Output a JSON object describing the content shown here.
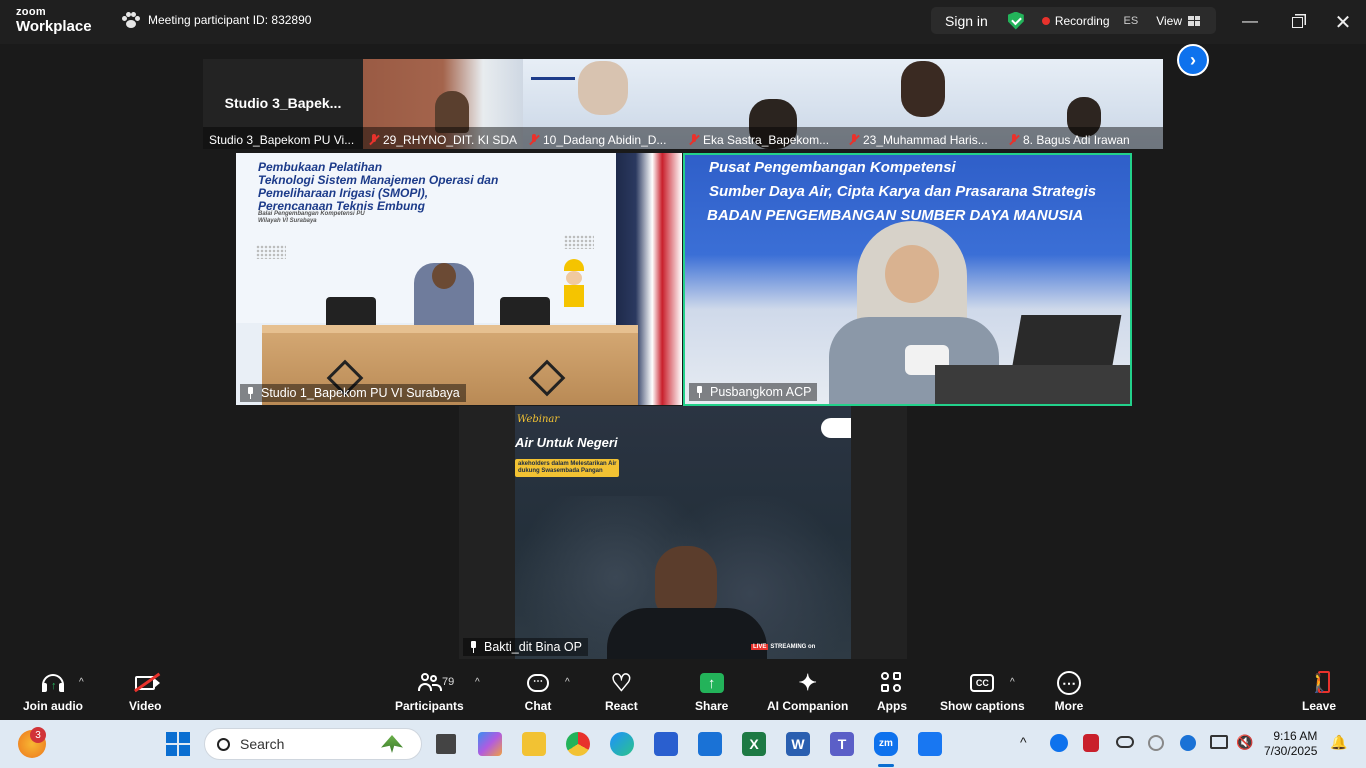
{
  "app": {
    "logo_line1": "zoom",
    "logo_line2": "Workplace",
    "meeting_id": "Meeting participant ID: 832890"
  },
  "titlebar": {
    "sign_in": "Sign in",
    "recording": "Recording",
    "lang": "ES",
    "view": "View"
  },
  "strip": {
    "tiles": [
      {
        "name": "Studio 3_Bapekom PU Vi...",
        "big_name": "Studio  3_Bapek...",
        "muted": false
      },
      {
        "name": "29_RHYNO_DIT. KI SDA",
        "muted": true
      },
      {
        "name": "10_Dadang Abidin_D...",
        "muted": true
      },
      {
        "name": "Eka Sastra_Bapekom...",
        "muted": true
      },
      {
        "name": "23_Muhammad Haris...",
        "muted": true
      },
      {
        "name": "8. Bagus Adi Irawan",
        "muted": true
      }
    ]
  },
  "main": {
    "tile1": {
      "name": "Studio 1_Bapekom PU VI Surabaya",
      "slide_title": "Pembukaan Pelatihan\nTeknologi Sistem Manajemen Operasi dan\nPemeliharaan Irigasi (SMOPI),\nPerencanaan Teknis Embung",
      "slide_sub": "Balai Pengembangan Kompetensi PU\nWilayah VI Surabaya"
    },
    "tile2": {
      "name": "Pusbangkom ACP",
      "banner1": "Pusat Pengembangan Kompetensi",
      "banner2": "Sumber Daya Air, Cipta Karya dan Prasarana Strategis",
      "banner3": "BADAN PENGEMBANGAN SUMBER DAYA MANUSIA"
    },
    "tile3": {
      "name": "Bakti_dit Bina OP",
      "webinar": "Webinar",
      "headline": "Air Untuk Negeri",
      "tagline": "akeholders dalam Melestarikan Air\ndukung Swasembada Pangan",
      "streaming": "STREAMING on"
    }
  },
  "toolbar": {
    "join_audio": "Join audio",
    "video": "Video",
    "participants": "Participants",
    "participants_count": "79",
    "chat": "Chat",
    "react": "React",
    "share": "Share",
    "ai_companion": "AI Companion",
    "apps": "Apps",
    "show_captions": "Show captions",
    "more": "More",
    "leave": "Leave"
  },
  "taskbar": {
    "notif_count": "3",
    "search_placeholder": "Search",
    "time": "9:16 AM",
    "date": "7/30/2025"
  },
  "colors": {
    "accent": "#0e72ed",
    "active_speaker": "#23d18b",
    "recording": "#e8322c",
    "share": "#23b35a"
  }
}
